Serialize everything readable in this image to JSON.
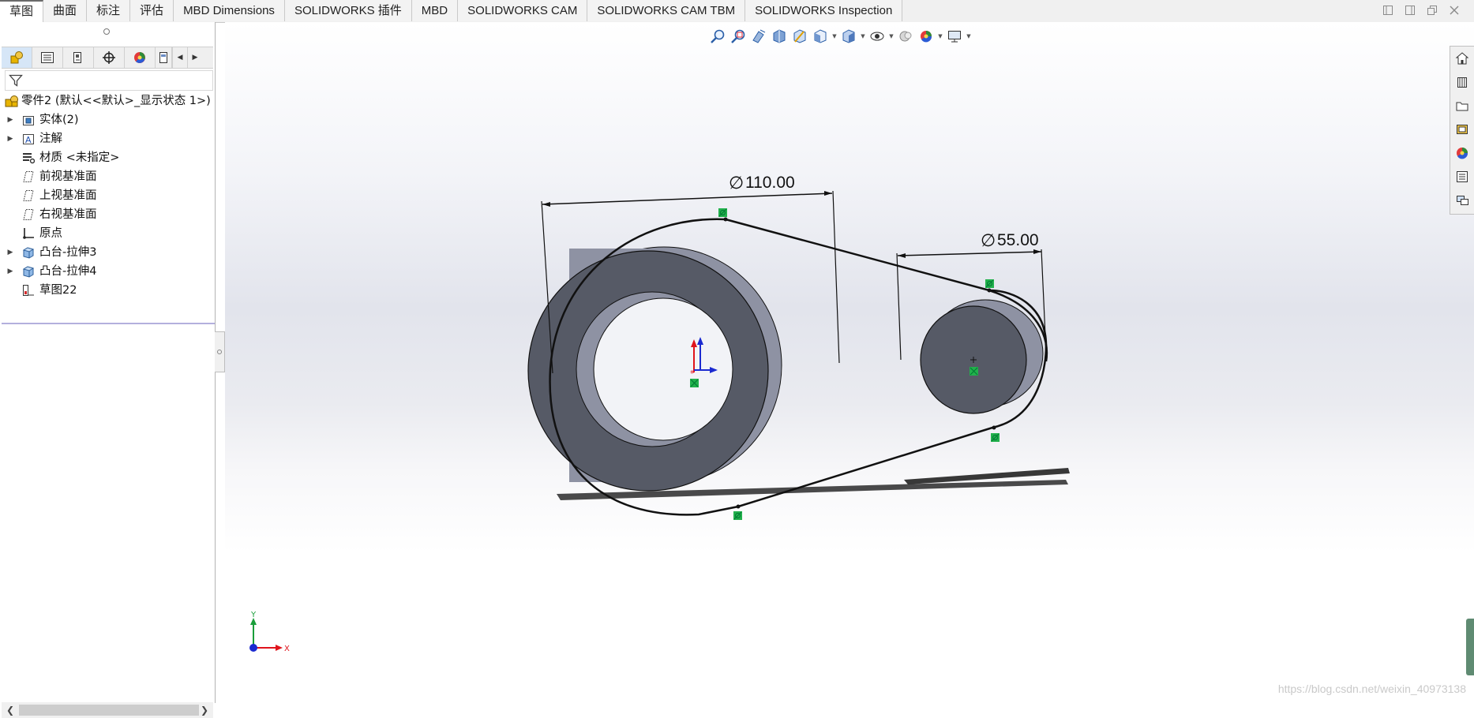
{
  "tabs": [
    "草图",
    "曲面",
    "标注",
    "评估",
    "MBD Dimensions",
    "SOLIDWORKS 插件",
    "MBD",
    "SOLIDWORKS CAM",
    "SOLIDWORKS CAM TBM",
    "SOLIDWORKS Inspection"
  ],
  "active_tab": "草图",
  "feature_tree": {
    "root": "零件2 (默认<<默认>_显示状态 1>)",
    "items": [
      {
        "label": "实体(2)",
        "icon": "solid-bodies-icon",
        "expandable": true
      },
      {
        "label": "注解",
        "icon": "annotations-icon",
        "expandable": true
      },
      {
        "label": "材质 <未指定>",
        "icon": "material-icon",
        "expandable": false
      },
      {
        "label": "前视基准面",
        "icon": "plane-icon",
        "expandable": false
      },
      {
        "label": "上视基准面",
        "icon": "plane-icon",
        "expandable": false
      },
      {
        "label": "右视基准面",
        "icon": "plane-icon",
        "expandable": false
      },
      {
        "label": "原点",
        "icon": "origin-icon",
        "expandable": false
      },
      {
        "label": "凸台-拉伸3",
        "icon": "boss-extrude-icon",
        "expandable": true
      },
      {
        "label": "凸台-拉伸4",
        "icon": "boss-extrude-icon",
        "expandable": true
      },
      {
        "label": "草图22",
        "icon": "sketch-icon",
        "expandable": false
      }
    ]
  },
  "dimensions": {
    "large_diameter": "110.00",
    "small_diameter": "55.00",
    "diameter_symbol": "∅"
  },
  "triad": {
    "x_label": "X",
    "y_label": "Y"
  },
  "watermark": "https://blog.csdn.net/weixin_40973138",
  "colors": {
    "part_face": "#565a66",
    "part_side": "#8e92a3",
    "sketch_line": "#111111",
    "relation_marker": "#22b14c",
    "axis_x": "#e0141c",
    "axis_y": "#1a9e3a",
    "axis_z": "#1b2ad0"
  }
}
